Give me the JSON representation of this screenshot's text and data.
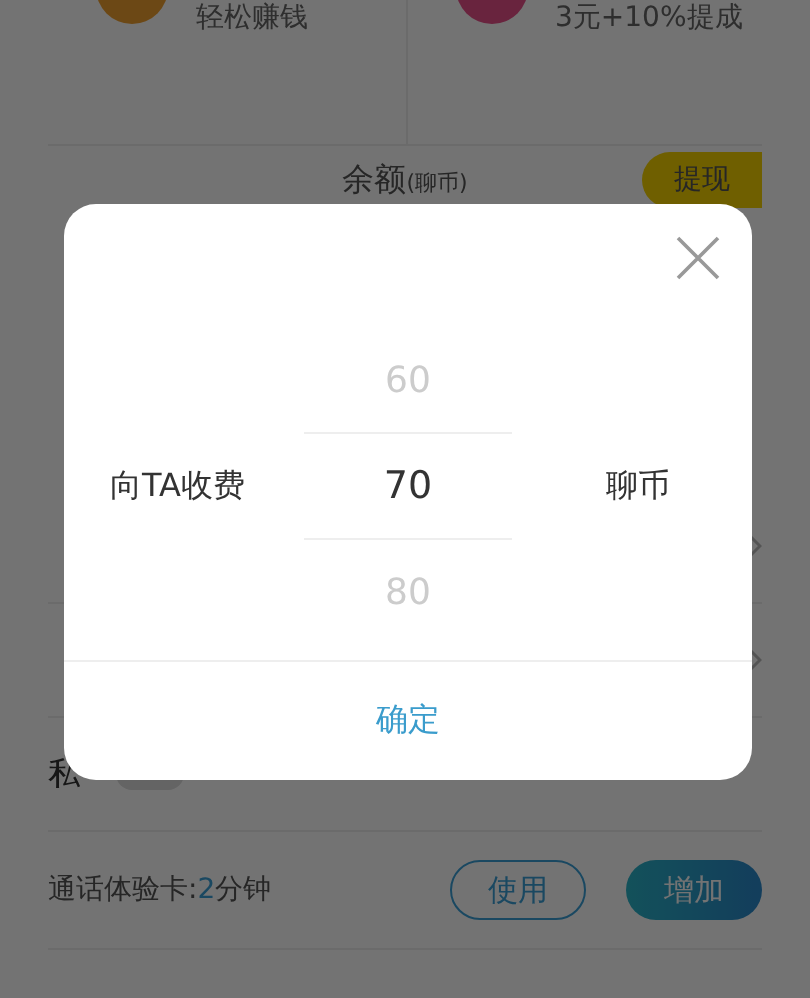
{
  "background": {
    "earn_items": [
      {
        "text": "轻松赚钱"
      },
      {
        "text": "3元+10%提成"
      }
    ],
    "balance": {
      "label": "余额",
      "unit": "(聊币)",
      "withdraw_button": "提现"
    },
    "settings_rows": [
      {
        "kind": "link"
      },
      {
        "kind": "link"
      },
      {
        "kind": "toggle",
        "label": "私",
        "on": false
      }
    ],
    "trial_card": {
      "label": "通话体验卡:",
      "value": "2",
      "unit": "分钟",
      "use_button": "使用",
      "add_button": "增加"
    }
  },
  "dialog": {
    "label": "向TA收费",
    "options": [
      {
        "value": "60",
        "selected": false
      },
      {
        "value": "70",
        "selected": true
      },
      {
        "value": "80",
        "selected": false
      }
    ],
    "unit": "聊币",
    "confirm_button": "确定"
  }
}
